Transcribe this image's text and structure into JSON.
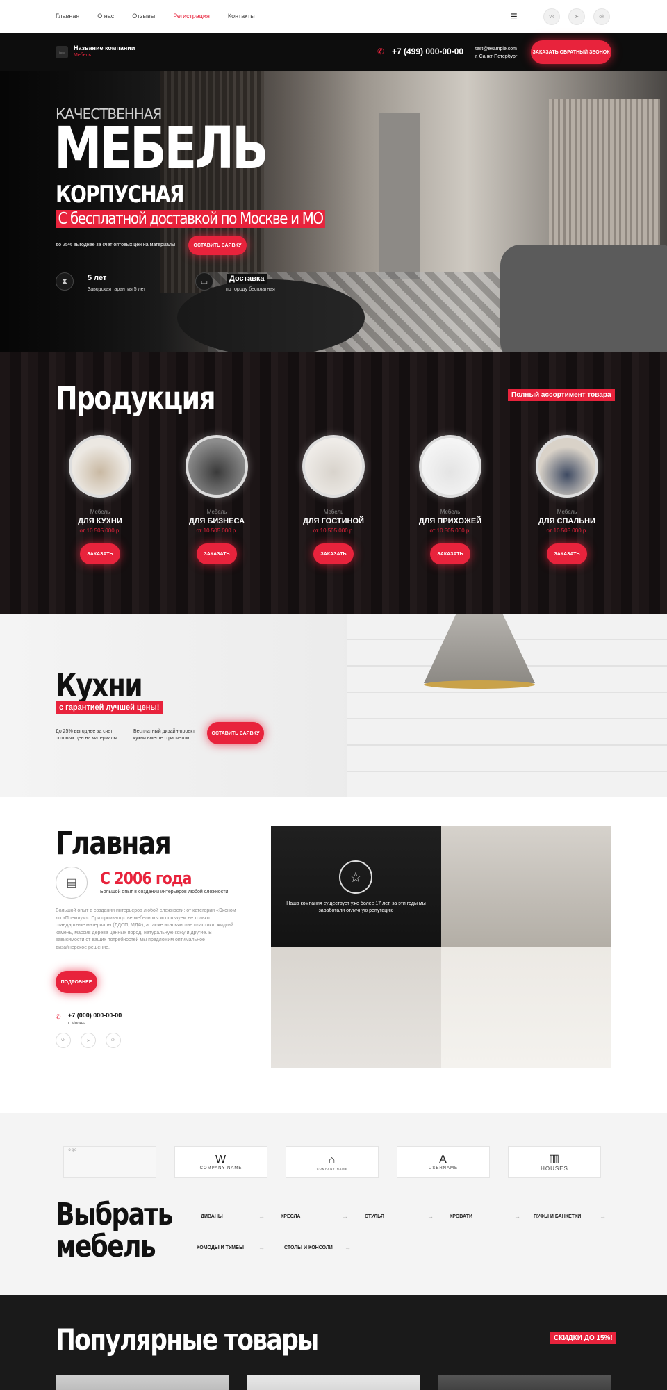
{
  "nav": {
    "links": [
      "Главная",
      "О нас",
      "Отзывы",
      "Регистрация",
      "Контакты"
    ],
    "active_index": 3,
    "menu_icon": "hamburger-icon",
    "social": [
      "vk",
      "tg",
      "ok"
    ]
  },
  "header": {
    "company_name": "Название компании",
    "company_sub": "Мебель",
    "logo_text": "logo",
    "phone": "+7 (499) 000-00-00",
    "email": "test@example.com",
    "city": "г. Санкт-Петербург",
    "callback_button": "Заказать обратный звонок"
  },
  "hero": {
    "pre": "КАЧЕСТВЕННАЯ",
    "title": "МЕБЕЛЬ",
    "subtitle": "КОРПУСНАЯ",
    "delivery": "С бесплатной доставкой по Москве и МО",
    "desc": "до 25% выгоднее за счет оптовых цен на материалы",
    "button": "Оставить заявку",
    "features": [
      {
        "title": "5 лет",
        "sub": "Заводская гарантия 5 лет",
        "icon": "hourglass-icon"
      },
      {
        "title": "Доставка",
        "sub": "по городу бесплатная",
        "icon": "truck-icon"
      }
    ]
  },
  "products": {
    "title": "Продукция",
    "badge": "Полный ассортимент товара",
    "items": [
      {
        "small": "Мебель",
        "name": "ДЛЯ КУХНИ",
        "price": "от 10 505 000 р.",
        "button": "Заказать"
      },
      {
        "small": "Мебель",
        "name": "ДЛЯ БИЗНЕСА",
        "price": "от 10 505 000 р.",
        "button": "Заказать"
      },
      {
        "small": "Мебель",
        "name": "ДЛЯ ГОСТИНОЙ",
        "price": "от 10 505 000 р.",
        "button": "Заказать"
      },
      {
        "small": "Мебель",
        "name": "ДЛЯ ПРИХОЖЕЙ",
        "price": "от 10 505 000 р.",
        "button": "Заказать"
      },
      {
        "small": "Мебель",
        "name": "ДЛЯ СПАЛЬНИ",
        "price": "от 10 505 000 р.",
        "button": "Заказать"
      }
    ]
  },
  "kitchens": {
    "title": "Кухни",
    "badge": "с гарантией лучшей цены!",
    "text1": "До 25% выгоднее за счет оптовых цен на материалы",
    "text2": "Бесплатный дизайн-проект кухни вместе с расчетом",
    "button": "Оставить заявку"
  },
  "main": {
    "title": "Главная",
    "since": "С 2006 года",
    "since_sub": "Большой опыт в создании интерьеров любой сложности",
    "paragraph": "Большой опыт в создании интерьеров любой сложности: от категории «Эконом до «Премиум». При производстве мебели мы используем не только стандартные материалы (ЛДСП, МДФ), а также итальянские пластики, жидкий камень, массив дерева ценных пород, натуральную кожу и другие. В зависимости от ваших потребностей мы предложим оптимальное дизайнерское решение.",
    "more_button": "Подробнее",
    "phone": "+7 (000) 000-00-00",
    "city": "г. Москва",
    "grid_text": "Наша компания существует уже более 17 лет, за эти годы мы заработали отличную репутацию"
  },
  "brands": {
    "logos": [
      {
        "name": "logo",
        "mark": ""
      },
      {
        "name": "COMPANY NAME",
        "mark": "W"
      },
      {
        "name": "COMPANY NAME",
        "mark": "⌂"
      },
      {
        "name": "USERNAME",
        "mark": "A"
      },
      {
        "name": "HOUSES",
        "mark": "▥"
      }
    ],
    "title_line1": "Выбрать",
    "title_line2": "мебель",
    "categories": [
      "ДИВАНЫ",
      "КРЕСЛА",
      "СТУЛЬЯ",
      "КРОВАТИ",
      "ПУФЫ И БАНКЕТКИ",
      "КОМОДЫ И ТУМБЫ",
      "СТОЛЫ И КОНСОЛИ"
    ]
  },
  "popular": {
    "title": "Популярные товары",
    "badge": "СКИДКИ ДО 15%!"
  },
  "colors": {
    "accent": "#e8233c",
    "dark": "#0d0d0d"
  }
}
